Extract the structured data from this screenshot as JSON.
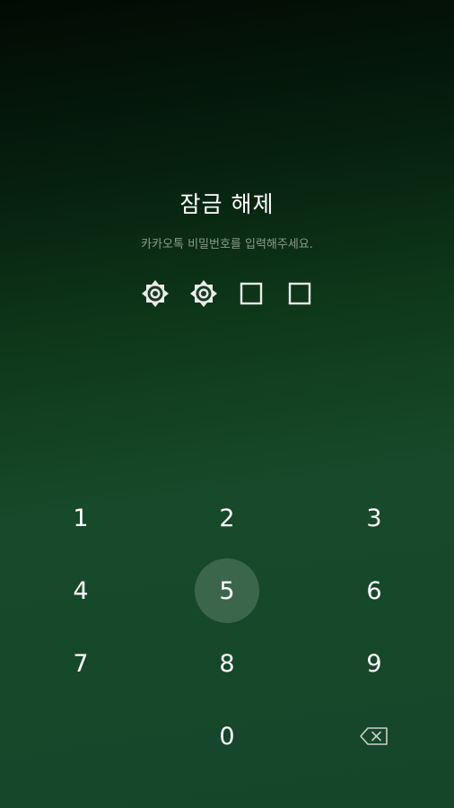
{
  "screen": {
    "title": "잠금 해제",
    "subtitle": "카카오톡 비밀번호를 입력해주세요."
  },
  "pin": {
    "length": 4,
    "entered": 2,
    "filled_icon": "gear-star-icon",
    "empty_icon": "empty-square-icon"
  },
  "keypad": {
    "keys": [
      "1",
      "2",
      "3",
      "4",
      "5",
      "6",
      "7",
      "8",
      "9",
      "0"
    ],
    "pressed": "5",
    "backspace_icon": "backspace-icon"
  },
  "colors": {
    "background_top": "#020a04",
    "background_bottom": "#15462a",
    "subtitle": "#8c9a8f",
    "text": "#ffffff"
  }
}
